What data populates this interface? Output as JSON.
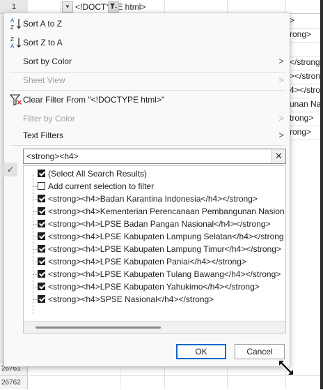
{
  "sheet": {
    "row_top": "1",
    "cell_b1": "<!DOCTYPE html>",
    "right_fragments": [
      ">",
      "rong>",
      "",
      "</strong",
      "></strong>",
      "4></strong",
      "unan Nas",
      "trong>",
      "rong>"
    ],
    "bottom_rows": [
      "26761",
      "26762"
    ]
  },
  "menu": {
    "sort_a_z": "Sort A to Z",
    "sort_z_a": "Sort Z to A",
    "sort_by_color": "Sort by Color",
    "sheet_view": "Sheet View",
    "clear_filter": "Clear Filter From \"<!DOCTYPE html>\"",
    "filter_by_color": "Filter by Color",
    "text_filters": "Text Filters"
  },
  "search": {
    "value": "<strong><h4>",
    "clear_symbol": "✕"
  },
  "list": {
    "items": [
      {
        "label": "(Select All Search Results)",
        "checked": true
      },
      {
        "label": "Add current selection to filter",
        "checked": false
      },
      {
        "label": "<strong><h4>Badan Karantina Indonesia</h4></strong>",
        "checked": true
      },
      {
        "label": "<strong><h4>Kementerian Perencanaan Pembangunan Nasion",
        "checked": true
      },
      {
        "label": "<strong><h4>LPSE Badan Pangan Nasional</h4></strong>",
        "checked": true
      },
      {
        "label": "<strong><h4>LPSE Kabupaten Lampung Selatan</h4></strong",
        "checked": true
      },
      {
        "label": "<strong><h4>LPSE Kabupaten Lampung Timur</h4></strong>",
        "checked": true
      },
      {
        "label": "<strong><h4>LPSE Kabupaten Paniai</h4></strong>",
        "checked": true
      },
      {
        "label": "<strong><h4>LPSE Kabupaten Tulang Bawang</h4></strong>",
        "checked": true
      },
      {
        "label": "<strong><h4>LPSE Kabupaten Yahukimo</h4></strong>",
        "checked": true
      },
      {
        "label": "<strong><h4>SPSE Nasional</h4></strong>",
        "checked": true
      }
    ]
  },
  "buttons": {
    "ok": "OK",
    "cancel": "Cancel"
  },
  "colors": {
    "accent": "#1167c9",
    "clear_filter_icon_x": "#d13438"
  },
  "icons": {
    "sort_asc": "sort-a-to-z-icon",
    "sort_desc": "sort-z-to-a-icon",
    "clear_filter": "clear-filter-icon",
    "submenu": "chevron-right-icon",
    "search_clear": "close-icon",
    "resize": "resize-grip-icon"
  }
}
